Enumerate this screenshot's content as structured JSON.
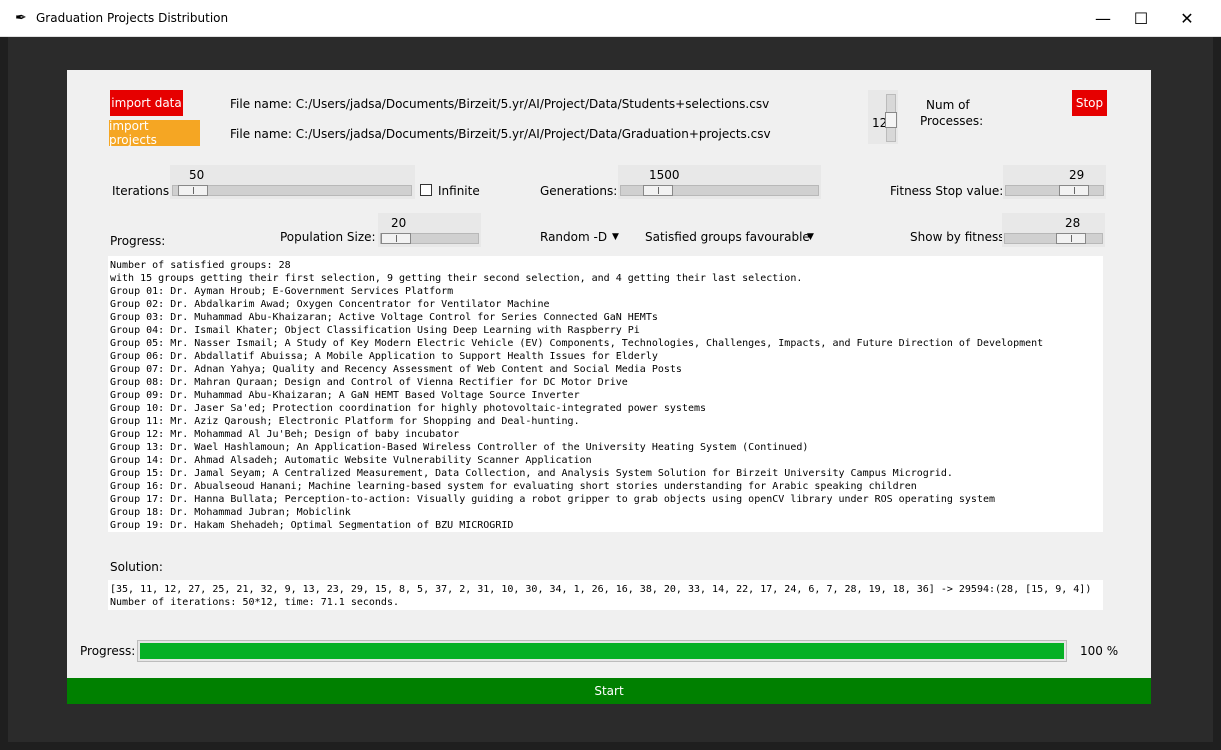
{
  "window": {
    "title": "Graduation Projects Distribution",
    "minimize": "—",
    "maximize": "☐",
    "close": "✕"
  },
  "top": {
    "import_data_label": "import data",
    "import_projects_label": "import projects",
    "students_file_label": "File name:  C:/Users/jadsa/Documents/Birzeit/5.yr/AI/Project/Data/Students+selections.csv",
    "projects_file_label": "File name:  C:/Users/jadsa/Documents/Birzeit/5.yr/AI/Project/Data/Graduation+projects.csv",
    "processes_value": "12",
    "processes_label_1": "Num of",
    "processes_label_2": "Processes:",
    "stop_label": "Stop"
  },
  "controls": {
    "iterations_label": "Iterations:",
    "iterations_value": "50",
    "infinite_label": "Infinite",
    "generations_label": "Generations:",
    "generations_value": "1500",
    "fitness_stop_label": "Fitness Stop value:",
    "fitness_stop_value": "29",
    "progress_label": "Progress:",
    "population_label": "Population Size:",
    "population_value": "20",
    "selection_value": "Random -D",
    "favour_value": "Satisfied groups favourable",
    "show_fitness_label": "Show by fitness:",
    "show_fitness_value": "28"
  },
  "results": {
    "lines": [
      "Number of satisfied groups: 28",
      "with 15 groups getting their first selection, 9 getting their second selection, and 4 getting their last selection.",
      "Group 01: Dr. Ayman Hroub; E-Government Services Platform",
      "Group 02: Dr. Abdalkarim Awad; Oxygen Concentrator for Ventilator Machine",
      "Group 03: Dr. Muhammad Abu-Khaizaran; Active Voltage Control for Series Connected GaN HEMTs",
      "Group 04: Dr. Ismail Khater; Object Classification Using Deep Learning with Raspberry Pi",
      "Group 05: Mr. Nasser Ismail; A Study of Key Modern Electric Vehicle (EV) Components, Technologies, Challenges, Impacts, and Future Direction of Development",
      "Group 06: Dr. Abdallatif Abuissa; A Mobile Application to Support Health Issues for Elderly",
      "Group 07: Dr. Adnan Yahya; Quality and Recency Assessment of Web Content and Social Media Posts",
      "Group 08: Dr. Mahran Quraan; Design and Control of Vienna Rectifier for DC Motor Drive",
      "Group 09: Dr. Muhammad Abu-Khaizaran; A GaN HEMT Based Voltage Source Inverter",
      "Group 10: Dr. Jaser Sa'ed; Protection coordination for highly photovoltaic-integrated power systems",
      "Group 11: Mr. Aziz Qaroush; Electronic Platform for Shopping and Deal-hunting.",
      "Group 12: Mr. Mohammad Al Ju'Beh; Design of baby incubator",
      "Group 13: Dr. Wael Hashlamoun; An Application-Based Wireless Controller of the University Heating System (Continued)",
      "Group 14: Dr. Ahmad Alsadeh; Automatic Website Vulnerability Scanner Application",
      "Group 15: Dr. Jamal Seyam; A Centralized Measurement, Data Collection, and Analysis System Solution for Birzeit University Campus Microgrid.",
      "Group 16: Dr. Abualseoud Hanani; Machine learning-based system for evaluating short stories understanding for Arabic speaking children",
      "Group 17: Dr. Hanna Bullata; Perception-to-action: Visually guiding a robot gripper to grab objects using openCV library under ROS operating system",
      "Group 18: Dr. Mohammad Jubran; Mobiclink",
      "Group 19: Dr. Hakam Shehadeh; Optimal Segmentation of BZU MICROGRID"
    ]
  },
  "solution": {
    "label": "Solution:",
    "lines": [
      "[35, 11, 12, 27, 25, 21, 32, 9, 13, 23, 29, 15, 8, 5, 37, 2, 31, 10, 30, 34, 1, 26, 16, 38, 20, 33, 14, 22, 17, 24, 6, 7, 28, 19, 18, 36] -> 29594:(28, [15, 9, 4])",
      "Number of iterations: 50*12, time: 71.1 seconds."
    ]
  },
  "progress": {
    "label": "Progress:",
    "percent_text": "100 %",
    "fraction": 1.0
  },
  "start_label": "Start",
  "colors": {
    "danger": "#e60000",
    "warning": "#f5a623",
    "progress": "#06b025",
    "start": "#008000"
  }
}
